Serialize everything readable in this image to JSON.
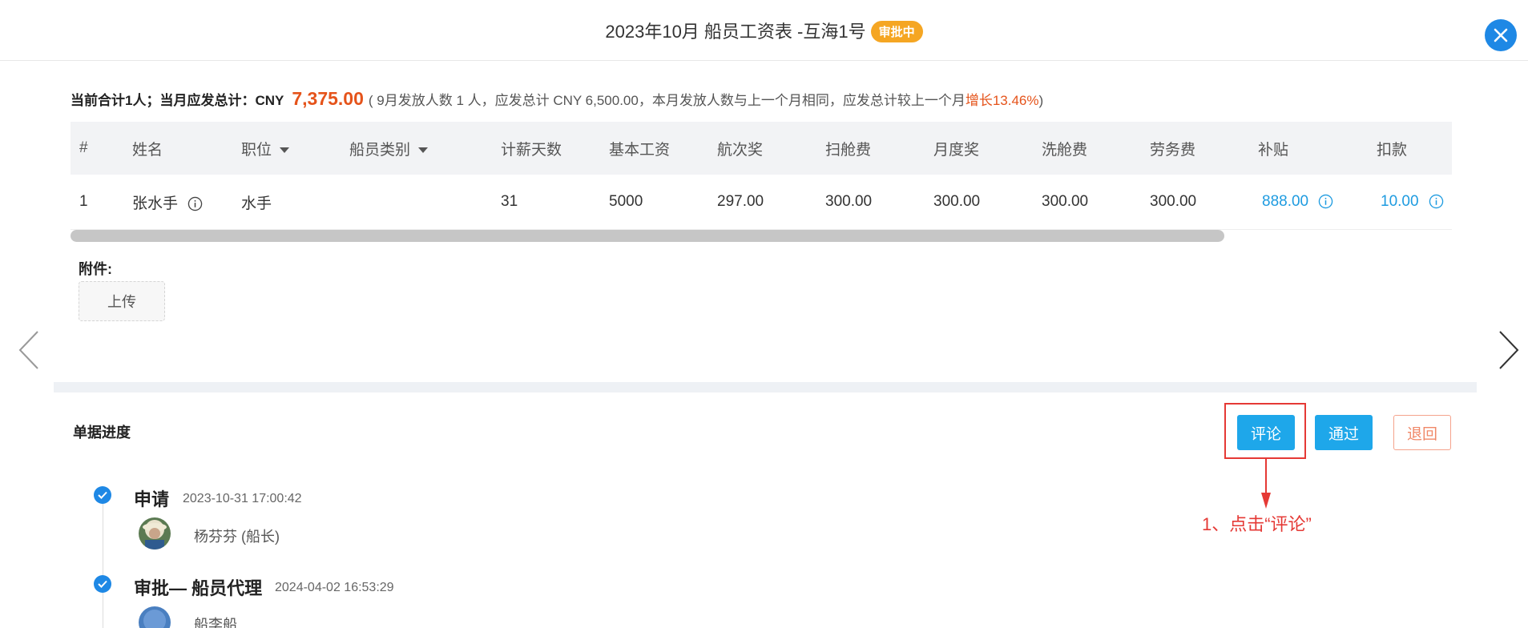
{
  "header": {
    "title": "2023年10月 船员工资表 -互海1号",
    "status_badge": "审批中"
  },
  "summary": {
    "lead": "当前合计1人；当月应发总计：CNY",
    "total": "7,375.00",
    "note_before": "( 9月发放人数 1 人，应发总计 CNY 6,500.00，本月发放人数与上一个月相同，应发总计较上一个月",
    "note_highlight": "增长13.46%",
    "note_after": ")"
  },
  "table": {
    "headers": [
      "#",
      "姓名",
      "职位",
      "船员类别",
      "计薪天数",
      "基本工资",
      "航次奖",
      "扫舱费",
      "月度奖",
      "洗舱费",
      "劳务费",
      "补贴",
      "扣款"
    ],
    "rows": [
      [
        "1",
        "张水手",
        "水手",
        "",
        "31",
        "5000",
        "297.00",
        "300.00",
        "300.00",
        "300.00",
        "300.00",
        "888.00",
        "10.00"
      ]
    ]
  },
  "attachments": {
    "label": "附件:",
    "upload_label": "上传"
  },
  "progress": {
    "title": "单据进度",
    "actions": {
      "comment": "评论",
      "approve": "通过",
      "return": "退回"
    },
    "annotation": "1、点击“评论”",
    "steps": [
      {
        "title": "申请",
        "time": "2023-10-31 17:00:42",
        "person": "杨芬芬  (船长)"
      },
      {
        "title": "审批— 船员代理",
        "time": "2024-04-02 16:53:29",
        "person": "船李船"
      }
    ]
  },
  "colors": {
    "accent": "#1ea7ea",
    "badge": "#f5a623",
    "highlight_red": "#e53935",
    "amount_orange": "#e5531a"
  },
  "icons": [
    "close-icon",
    "info-icon",
    "caret-down-icon",
    "chevron-left-icon",
    "chevron-right-icon",
    "check-icon",
    "arrow-down-icon"
  ]
}
